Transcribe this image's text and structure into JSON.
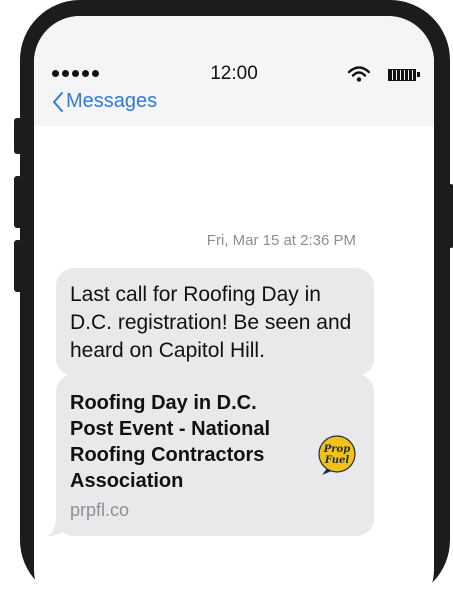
{
  "status_bar": {
    "time": "12:00"
  },
  "nav": {
    "back_label": "Messages"
  },
  "thread": {
    "timestamp": "Fri, Mar 15 at 2:36 PM",
    "message_text": "Last call for Roofing Day in D.C. registration! Be seen and heard on Capitol Hill.",
    "link_preview": {
      "title": "Roofing Day in D.C. Post Event - National Roofing Contractors Association",
      "domain": "prpfl.co",
      "logo_text": [
        "Prop",
        "Fuel"
      ]
    }
  },
  "colors": {
    "link_blue": "#2f7bd9",
    "bubble_gray": "#e9e9eb",
    "logo_yellow": "#f2c21b"
  }
}
